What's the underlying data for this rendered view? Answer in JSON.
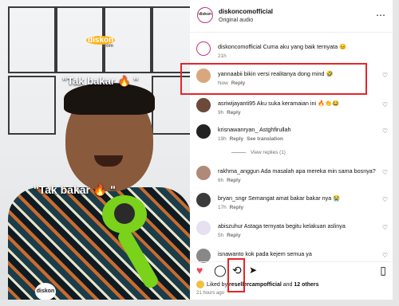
{
  "video": {
    "brand": "diskon",
    "brand_sub": ".com",
    "caption_top": "\"Tak bakar 🔥 \"",
    "caption_mid": "\"Tak bakar 🔥 \"",
    "bottom_brand": "diskon"
  },
  "header": {
    "username": "diskoncomofficial",
    "audio": "Original audio",
    "avatar_text": "diskon",
    "more_icon": "⋯"
  },
  "caption_comment": {
    "user": "diskoncomofficial",
    "text": "Cuma aku yang baik ternyata 😣",
    "time": "21h"
  },
  "comments": [
    {
      "user": "yannaabii",
      "text": "bikin versi realitanya dong mind 🤣",
      "time": "Now",
      "reply": "Reply",
      "extra": "",
      "avatar_color": "#d9a77e"
    },
    {
      "user": "asriwijayanti95",
      "text": "Aku suka keramaian ini 🔥👏😂",
      "time": "9h",
      "reply": "Reply",
      "extra": "",
      "avatar_color": "#6b4a3a"
    },
    {
      "user": "krisnawanryan_",
      "text": "Astghfirullah",
      "time": "19h",
      "reply": "Reply",
      "extra": "See translation",
      "avatar_color": "#222"
    },
    {
      "user": "rakhma_anggun",
      "text": "Ada masalah apa mereka min sama bosnya?",
      "time": "6h",
      "reply": "Reply",
      "extra": "",
      "avatar_color": "#b08a78"
    },
    {
      "user": "bryan_sngr",
      "text": "Semangat amat bakar bakar nya 😭",
      "time": "17h",
      "reply": "Reply",
      "extra": "",
      "avatar_color": "#3b3b3b"
    },
    {
      "user": "abiszuhur",
      "text": "Astaga ternyata begitu kelakuan aslinya",
      "time": "5h",
      "reply": "Reply",
      "extra": "",
      "avatar_color": "#e6e0f0"
    },
    {
      "user": "isnawanto",
      "text": "kok pada kejem semua ya",
      "time": "",
      "reply": "",
      "extra": "",
      "avatar_color": "#888"
    }
  ],
  "view_replies": "View replies (1)",
  "actions": {
    "like_icon": "♥",
    "comment_icon": "◯",
    "repost_icon": "⟲",
    "share_icon": "➤",
    "save_icon": "▯"
  },
  "likes": {
    "prefix": "Liked by",
    "user": "resellercampofficial",
    "joiner": "and",
    "others": "12 others"
  },
  "time_ago": "21 hours ago",
  "colors": {
    "accent": "#e3262b",
    "heart": "#ed4956",
    "ring": "#c13584"
  }
}
